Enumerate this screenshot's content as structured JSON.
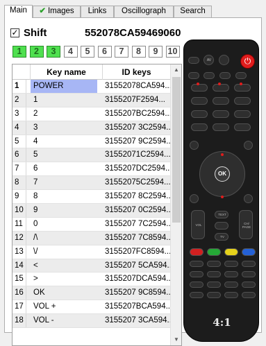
{
  "tabs": [
    {
      "label": "Main",
      "active": true
    },
    {
      "label": "Images",
      "checked": true
    },
    {
      "label": "Links"
    },
    {
      "label": "Oscillograph"
    },
    {
      "label": "Search"
    }
  ],
  "shift": {
    "label": "Shift",
    "checked": true
  },
  "current_id": "552078CA59469060",
  "pages": [
    {
      "label": "1",
      "on": true
    },
    {
      "label": "2",
      "on": true
    },
    {
      "label": "3",
      "on": true
    },
    {
      "label": "4"
    },
    {
      "label": "5"
    },
    {
      "label": "6"
    },
    {
      "label": "7"
    },
    {
      "label": "8"
    },
    {
      "label": "9"
    },
    {
      "label": "10"
    }
  ],
  "table": {
    "columns": [
      "Key name",
      "ID keys"
    ],
    "rows": [
      {
        "num": "1",
        "name": "POWER",
        "id": "31552078CA594..."
      },
      {
        "num": "2",
        "name": "1",
        "id": "3155207F2594..."
      },
      {
        "num": "3",
        "name": "2",
        "id": "3155207BC2594..."
      },
      {
        "num": "4",
        "name": "3",
        "id": "3155207 3C2594..."
      },
      {
        "num": "5",
        "name": "4",
        "id": "3155207 9C2594..."
      },
      {
        "num": "6",
        "name": "5",
        "id": "31552071C2594..."
      },
      {
        "num": "7",
        "name": "6",
        "id": "3155207DC2594..."
      },
      {
        "num": "8",
        "name": "7",
        "id": "31552075C2594..."
      },
      {
        "num": "9",
        "name": "8",
        "id": "3155207 8C2594..."
      },
      {
        "num": "10",
        "name": "9",
        "id": "3155207 0C2594..."
      },
      {
        "num": "11",
        "name": "0",
        "id": "3155207 7C2594..."
      },
      {
        "num": "12",
        "name": "/\\",
        "id": "3155207 7C8594..."
      },
      {
        "num": "13",
        "name": "\\/",
        "id": "3155207FC8594..."
      },
      {
        "num": "14",
        "name": "<",
        "id": "3155207 5CA594..."
      },
      {
        "num": "15",
        "name": ">",
        "id": "3155207DCA594..."
      },
      {
        "num": "16",
        "name": "OK",
        "id": "3155207 9C8594..."
      },
      {
        "num": "17",
        "name": "VOL +",
        "id": "3155207BCA594..."
      },
      {
        "num": "18",
        "name": "VOL -",
        "id": "3155207 3CA594..."
      }
    ]
  },
  "remote": {
    "logo": "4:1",
    "buttons": {
      "ok": "OK",
      "vol": "VOL",
      "ch": "CH/ PAGE",
      "tv": "TV",
      "text": "TEXT",
      "av": "AV"
    }
  }
}
